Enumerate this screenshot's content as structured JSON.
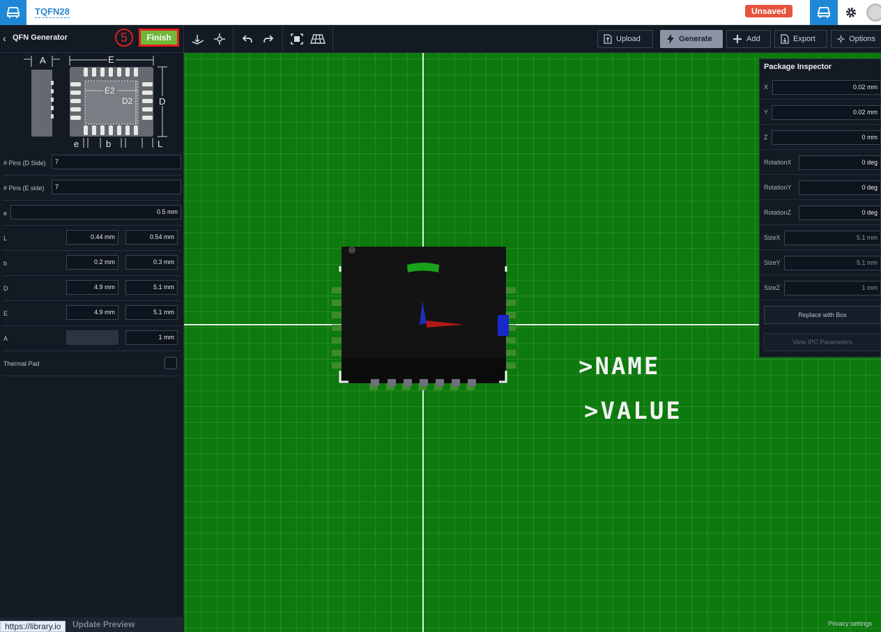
{
  "header": {
    "doc_title": "TQFN28",
    "status_badge": "Unsaved"
  },
  "panel": {
    "back_label": "‹",
    "title": "QFN Generator",
    "step_number": "5",
    "finish_label": "Finish",
    "diagram_labels": {
      "A": "A",
      "E": "E",
      "E2": "E2",
      "D2": "D2",
      "D": "D",
      "e": "e",
      "b": "b",
      "L": "L"
    },
    "params": [
      {
        "label": "# Pins (D Side)",
        "values": [
          "7"
        ]
      },
      {
        "label": "# Pins (E side)",
        "values": [
          "7"
        ]
      },
      {
        "label": "e",
        "values": [
          "0.5 mm"
        ]
      },
      {
        "label": "L",
        "values": [
          "0.44 mm",
          "0.54 mm"
        ]
      },
      {
        "label": "b",
        "values": [
          "0.2 mm",
          "0.3 mm"
        ]
      },
      {
        "label": "D",
        "values": [
          "4.9 mm",
          "5.1 mm"
        ]
      },
      {
        "label": "E",
        "values": [
          "4.9 mm",
          "5.1 mm"
        ]
      },
      {
        "label": "A",
        "values": [
          "",
          "1 mm"
        ]
      },
      {
        "label": "Thermal Pad",
        "checked": false
      }
    ],
    "update_preview_label": "Update Preview"
  },
  "toolbar": {
    "upload_label": "Upload",
    "generate_label": "Generate",
    "add_label": "Add",
    "export_label": "Export",
    "options_label": "Options"
  },
  "canvas": {
    "name_label": ">NAME",
    "value_label": ">VALUE",
    "privacy_label": "Privacy settings",
    "background_color": "#0c7a0c"
  },
  "inspector": {
    "title": "Package Inspector",
    "fields": [
      {
        "label": "X",
        "value": "0.02 mm",
        "editable": true
      },
      {
        "label": "Y",
        "value": "0.02 mm",
        "editable": true
      },
      {
        "label": "Z",
        "value": "0 mm",
        "editable": true
      },
      {
        "label": "RotationX",
        "value": "0 deg",
        "editable": true
      },
      {
        "label": "RotationY",
        "value": "0 deg",
        "editable": true
      },
      {
        "label": "RotationZ",
        "value": "0 deg",
        "editable": true
      },
      {
        "label": "SizeX",
        "value": "5.1 mm",
        "editable": false
      },
      {
        "label": "SizeY",
        "value": "5.1 mm",
        "editable": false
      },
      {
        "label": "SizeZ",
        "value": "1 mm",
        "editable": false
      }
    ],
    "replace_label": "Replace with Box",
    "ipc_label": "View IPC Parameters"
  },
  "statusbar": {
    "url": "https://library.io"
  },
  "colors": {
    "accent": "#1e88d6",
    "finish": "#6fb83a",
    "unsaved": "#e5533d",
    "highlight": "#e81a1a"
  }
}
